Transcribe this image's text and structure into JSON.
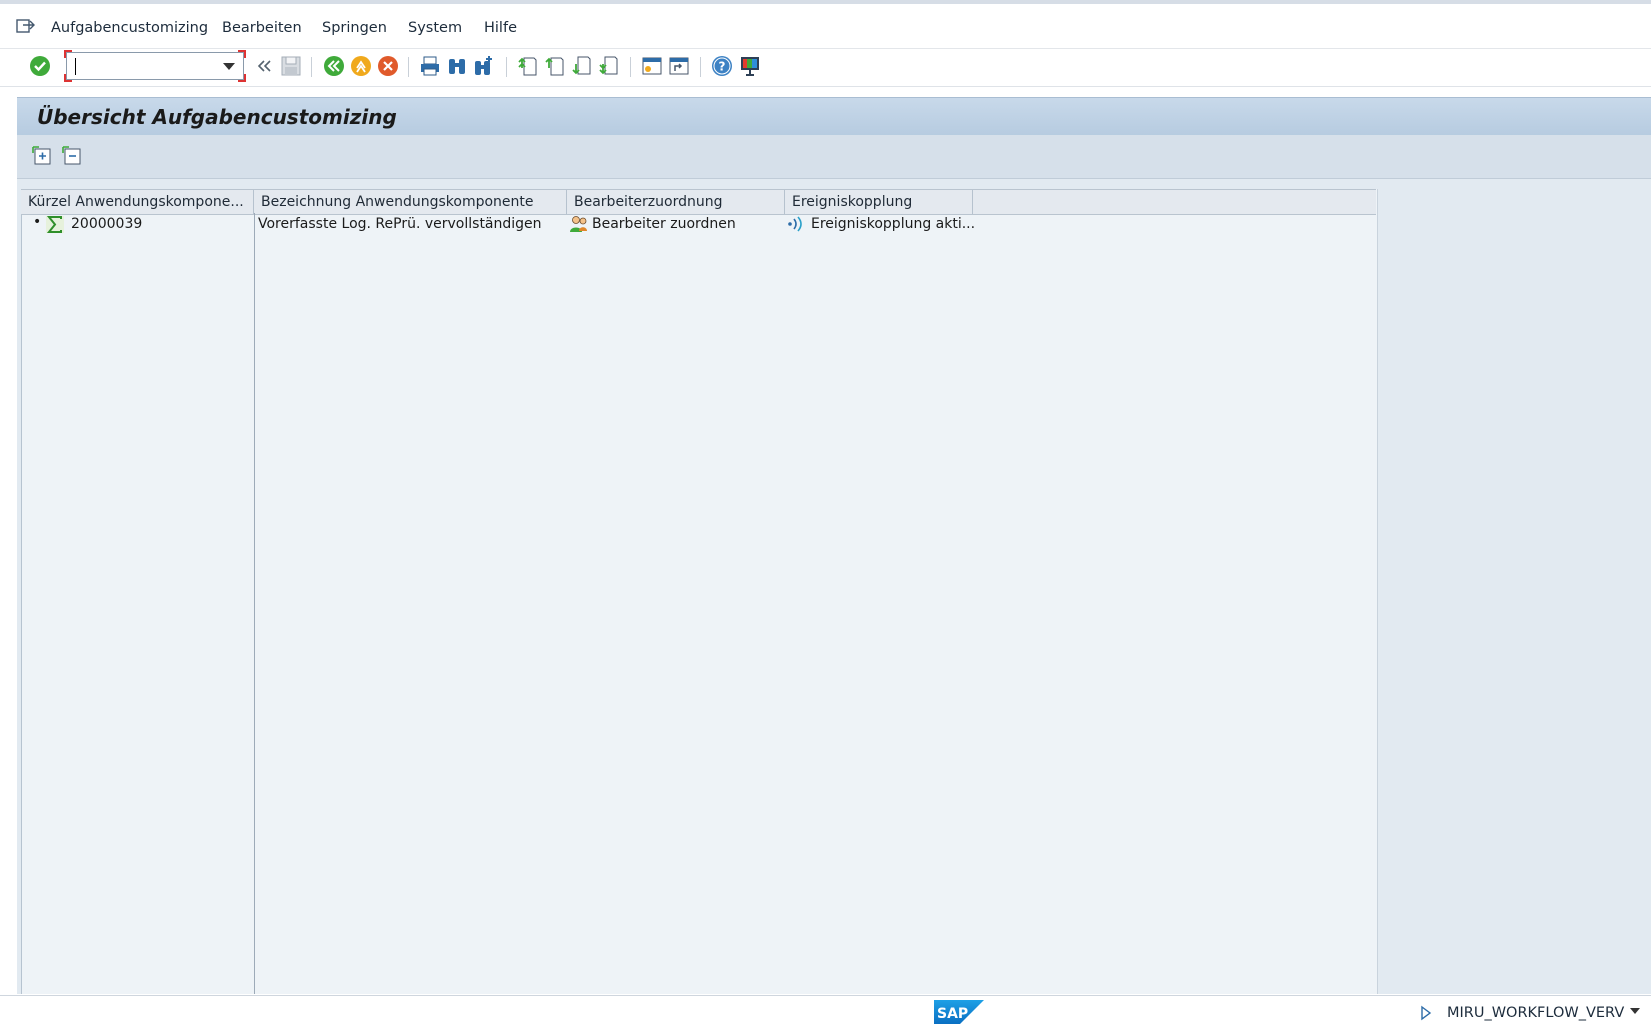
{
  "menubar": {
    "items": [
      {
        "label": "Aufgabencustomizing"
      },
      {
        "label": "Bearbeiten"
      },
      {
        "label": "Springen"
      },
      {
        "label": "System"
      },
      {
        "label": "Hilfe"
      }
    ]
  },
  "toolbar": {
    "command_field_value": "",
    "icons": [
      "enter-icon",
      "back-arrows-icon",
      "save-icon",
      "back-icon",
      "exit-icon",
      "cancel-icon",
      "print-icon",
      "find-icon",
      "find-next-icon",
      "first-page-icon",
      "previous-page-icon",
      "next-page-icon",
      "last-page-icon",
      "create-session-icon",
      "create-shortcut-icon",
      "help-icon",
      "customize-layout-icon"
    ]
  },
  "page": {
    "title": "Übersicht Aufgabencustomizing"
  },
  "tree": {
    "columns": [
      {
        "label": "Kürzel Anwendungskompone..."
      },
      {
        "label": "Bezeichnung Anwendungskomponente"
      },
      {
        "label": "Bearbeiterzuordnung"
      },
      {
        "label": "Ereigniskopplung"
      }
    ],
    "rows": [
      {
        "bullet": "•",
        "id": "20000039",
        "description": "Vorerfasste Log. RePrü. vervollständigen",
        "assignment": "Bearbeiter zuordnen",
        "event": "Ereigniskopplung akti..."
      }
    ]
  },
  "status": {
    "logo": "SAP",
    "system": "MIRU_WORKFLOW_VERV"
  },
  "colors": {
    "accent": "#008fd3",
    "title_bar": "#c0d3e6",
    "ok_green": "#3faa3a",
    "cancel_red": "#e05a2b"
  }
}
